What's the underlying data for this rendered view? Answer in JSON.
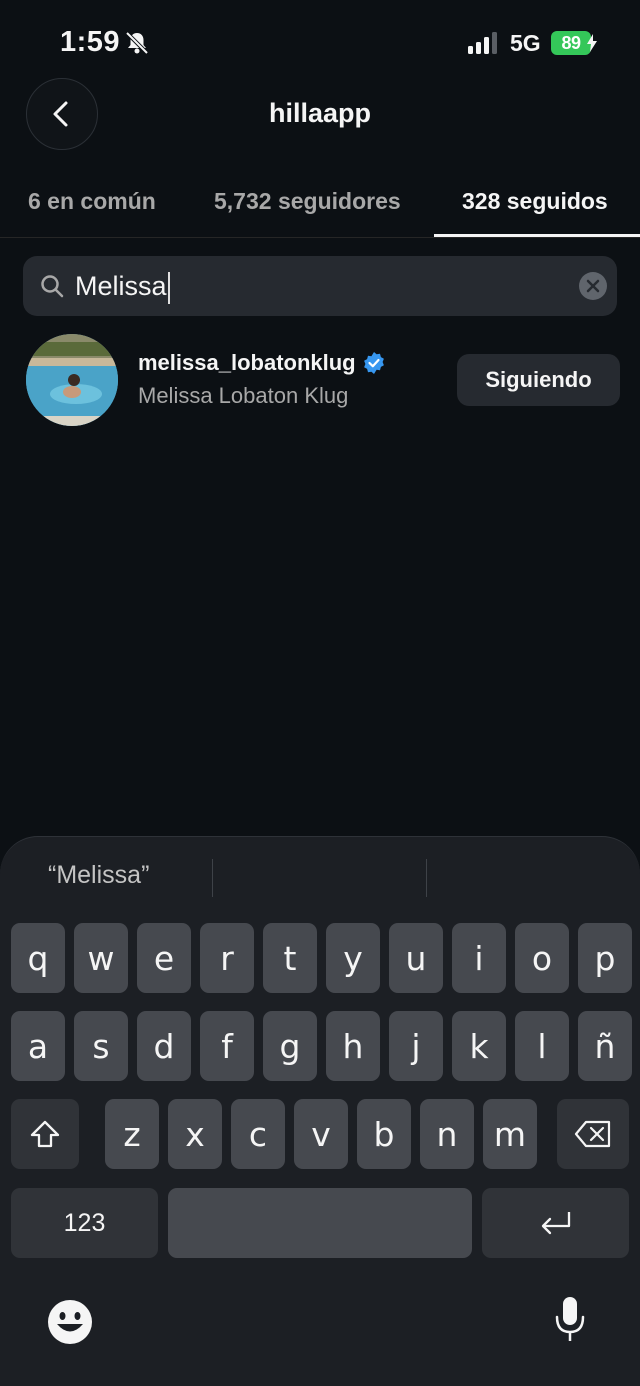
{
  "status_bar": {
    "time": "1:59",
    "network": "5G",
    "battery": "89",
    "icons": [
      "bell-slash-icon",
      "signal-bars-icon",
      "battery-charging-icon"
    ]
  },
  "header": {
    "title": "hillaapp",
    "back_icon": "chevron-left-icon"
  },
  "tabs": [
    {
      "label": "6 en común",
      "active": false
    },
    {
      "label": "5,732 seguidores",
      "active": false
    },
    {
      "label": "328 seguidos",
      "active": true
    }
  ],
  "search": {
    "value": "Melissa",
    "icons": [
      "search-icon",
      "clear-icon"
    ]
  },
  "results": [
    {
      "username": "melissa_lobatonklug",
      "full_name": "Melissa Lobaton Klug",
      "verified": true,
      "button_label": "Siguiendo"
    }
  ],
  "keyboard": {
    "suggestion": "“Melissa”",
    "row1": [
      "q",
      "w",
      "e",
      "r",
      "t",
      "y",
      "u",
      "i",
      "o",
      "p"
    ],
    "row2": [
      "a",
      "s",
      "d",
      "f",
      "g",
      "h",
      "j",
      "k",
      "l",
      "ñ"
    ],
    "row3": [
      "z",
      "x",
      "c",
      "v",
      "b",
      "n",
      "m"
    ],
    "numbers_key": "123",
    "icons": [
      "shift-icon",
      "backspace-icon",
      "return-icon",
      "emoji-icon",
      "microphone-icon"
    ]
  },
  "colors": {
    "background": "#0c1014",
    "keyboard_bg": "#1c1f24",
    "key": "#46494f",
    "verified_blue": "#3797f0",
    "battery_green": "#34c759"
  }
}
